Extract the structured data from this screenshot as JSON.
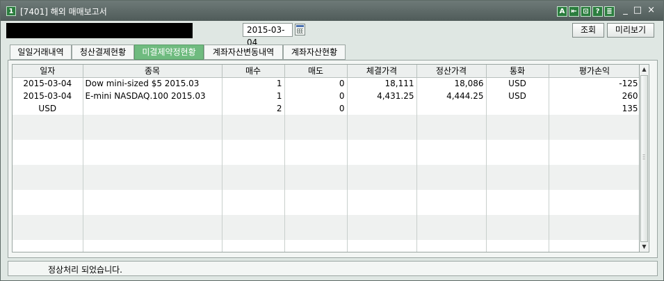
{
  "window": {
    "number_badge": "1",
    "title": "[7401] 해외 매매보고서",
    "title_icons": [
      "A",
      "⇤",
      "⊡",
      "?",
      "≣"
    ],
    "controls": [
      "_",
      "□",
      "×"
    ]
  },
  "toolbar": {
    "date": "2015-03-04",
    "search_label": "조회",
    "preview_label": "미리보기"
  },
  "tabs": [
    {
      "label": "일일거래내역"
    },
    {
      "label": "청산결제현황"
    },
    {
      "label": "미결제약정현황"
    },
    {
      "label": "계좌자산변동내역"
    },
    {
      "label": "계좌자산현황"
    }
  ],
  "active_tab": "미결제약정현황",
  "grid": {
    "columns": [
      "일자",
      "종목",
      "매수",
      "매도",
      "체결가격",
      "정산가격",
      "통화",
      "평가손익"
    ],
    "rows": [
      [
        "2015-03-04",
        "Dow mini-sized $5 2015.03",
        "1",
        "0",
        "18,111",
        "18,086",
        "USD",
        "-125"
      ],
      [
        "2015-03-04",
        "E-mini NASDAQ.100 2015.03",
        "1",
        "0",
        "4,431.25",
        "4,444.25",
        "USD",
        "260"
      ],
      [
        "USD",
        "",
        "2",
        "0",
        "",
        "",
        "",
        "135"
      ]
    ],
    "empty_rows": 11
  },
  "status": {
    "message": "정상처리 되었습니다."
  },
  "colors": {
    "active_tab": "#6fbb7f",
    "title_bar": "#5b6765",
    "badge_green": "#2b7d3e"
  }
}
